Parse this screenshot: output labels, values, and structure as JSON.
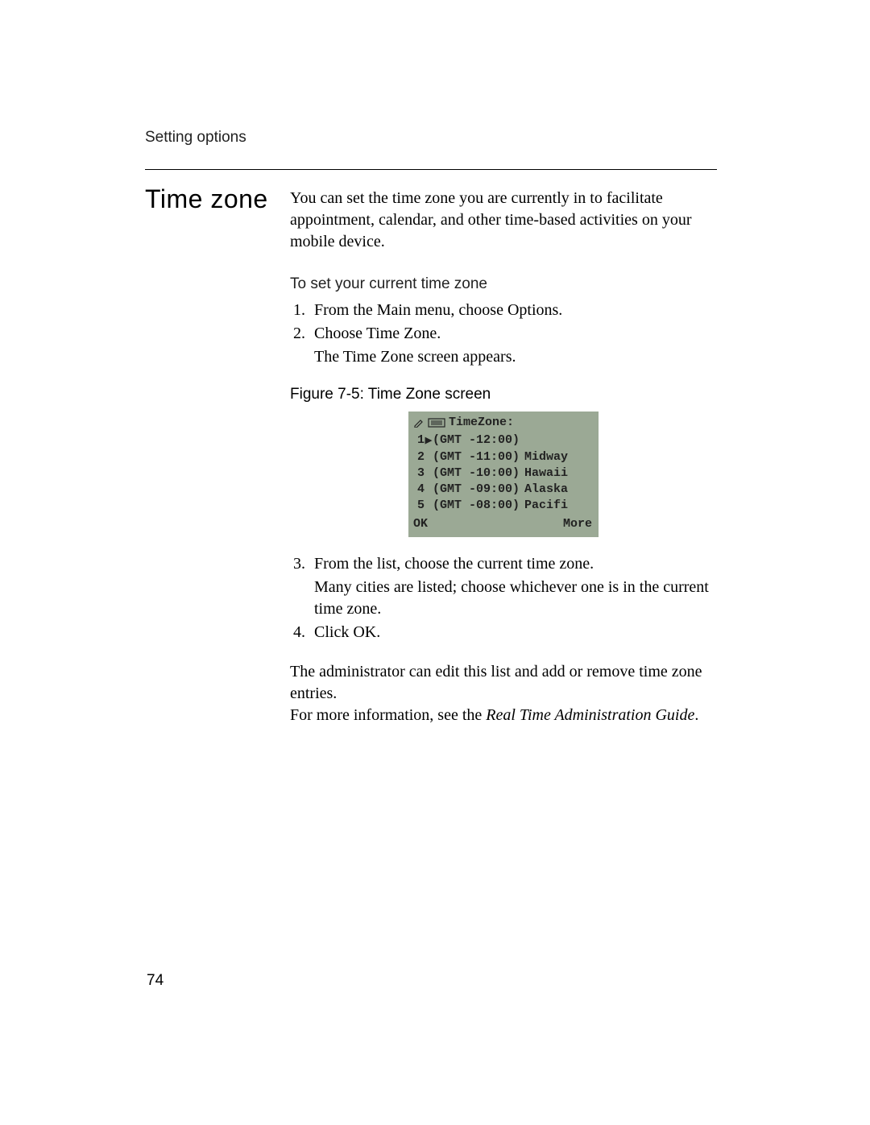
{
  "header": {
    "section": "Setting options"
  },
  "title": "Time zone",
  "intro": "You can set the time zone you are currently in to facilitate appointment, calendar, and other time-based activities on your mobile device.",
  "procedure": {
    "heading": "To set your current time zone",
    "steps_part1": [
      {
        "text": "From the Main menu, choose Options."
      },
      {
        "text": "Choose Time Zone.",
        "note": "The Time Zone screen appears."
      }
    ],
    "steps_part2": [
      {
        "text": "From the list, choose the current time zone.",
        "note": "Many cities are listed; choose whichever one is in the current time zone."
      },
      {
        "text": "Click OK."
      }
    ]
  },
  "figure": {
    "caption": "Figure 7-5: Time Zone screen",
    "screen": {
      "title": "TimeZone:",
      "items": [
        {
          "n": "1",
          "selected": true,
          "gmt": "(GMT -12:00)",
          "label": ""
        },
        {
          "n": "2",
          "selected": false,
          "gmt": "(GMT -11:00)",
          "label": "Midway"
        },
        {
          "n": "3",
          "selected": false,
          "gmt": "(GMT -10:00)",
          "label": "Hawaii"
        },
        {
          "n": "4",
          "selected": false,
          "gmt": "(GMT -09:00)",
          "label": "Alaska"
        },
        {
          "n": "5",
          "selected": false,
          "gmt": "(GMT -08:00)",
          "label": "Pacifi"
        }
      ],
      "ok": "OK",
      "more": "More"
    }
  },
  "closing": {
    "line1": "The administrator can edit this list and add or remove time zone entries.",
    "line2_prefix": "For more information, see the ",
    "line2_italic": "Real Time Administration Guide",
    "line2_suffix": "."
  },
  "page_number": "74"
}
